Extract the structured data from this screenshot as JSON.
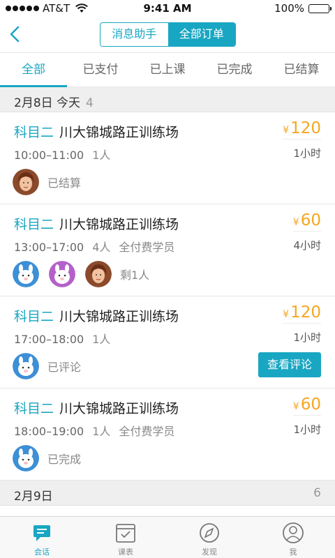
{
  "status_bar": {
    "carrier": "AT&T",
    "time": "9:41 AM",
    "battery": "100%"
  },
  "nav": {
    "back_icon": "chevron-left-icon",
    "segments": [
      "消息助手",
      "全部订单"
    ],
    "active_segment": 1
  },
  "tabs": [
    "全部",
    "已支付",
    "已上课",
    "已完成",
    "已结算"
  ],
  "sections": [
    {
      "date": "2月8日 今天",
      "count": "4"
    },
    {
      "date": "2月9日",
      "count": "6"
    }
  ],
  "orders": [
    {
      "subject": "科目二",
      "place": "川大锦城路正训练场",
      "time": "10:00–11:00",
      "people": "1人",
      "tag": "",
      "yen": "¥",
      "price": "120",
      "duration": "1小时",
      "status": "已结算",
      "button": ""
    },
    {
      "subject": "科目二",
      "place": "川大锦城路正训练场",
      "time": "13:00–17:00",
      "people": "4人",
      "tag": "全付费学员",
      "yen": "¥",
      "price": "60",
      "duration": "4小时",
      "status": "剩1人",
      "button": ""
    },
    {
      "subject": "科目二",
      "place": "川大锦城路正训练场",
      "time": "17:00–18:00",
      "people": "1人",
      "tag": "",
      "yen": "¥",
      "price": "120",
      "duration": "1小时",
      "status": "已评论",
      "button": "查看评论"
    },
    {
      "subject": "科目二",
      "place": "川大锦城路正训练场",
      "time": "18:00–19:00",
      "people": "1人",
      "tag": "全付费学员",
      "yen": "¥",
      "price": "60",
      "duration": "1小时",
      "status": "已完成",
      "button": ""
    }
  ],
  "tabbar": [
    {
      "label": "会话",
      "icon": "chat-icon",
      "active": true
    },
    {
      "label": "课表",
      "icon": "calendar-icon",
      "active": false
    },
    {
      "label": "发现",
      "icon": "compass-icon",
      "active": false
    },
    {
      "label": "我",
      "icon": "profile-icon",
      "active": false
    }
  ],
  "colors": {
    "accent": "#19a6c2",
    "price": "#f5a623"
  }
}
